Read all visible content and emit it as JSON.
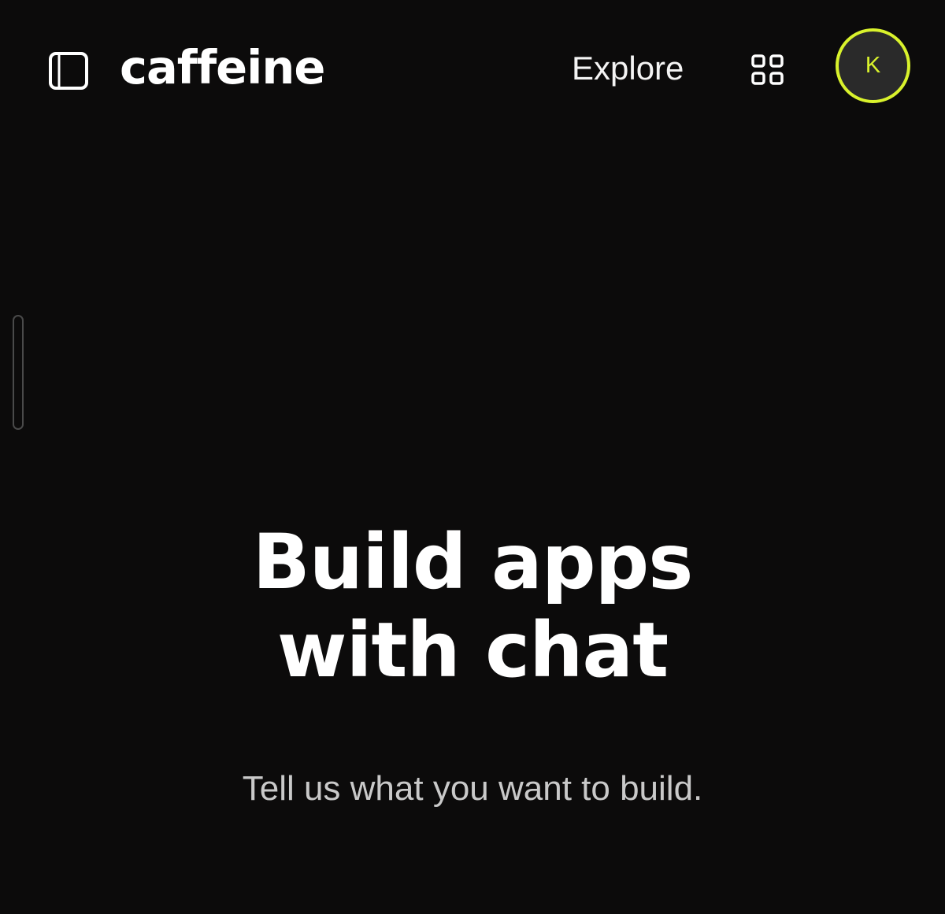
{
  "header": {
    "sidebar_toggle_icon": "sidebar-panel-icon",
    "brand_name": "caffeine",
    "nav": [
      {
        "label": "Explore"
      }
    ],
    "apps_icon": "grid-icon",
    "avatar": {
      "initial": "K",
      "ring_color": "#d9f22c",
      "background": "#2a2a2a"
    }
  },
  "hero": {
    "title_line_1": "Build apps",
    "title_line_2": "with chat",
    "subtitle": "Tell us what you want to build."
  },
  "colors": {
    "background": "#0c0b0b",
    "accent": "#d9f22c",
    "text": "#ffffff",
    "muted_text": "#c9c9c9"
  }
}
